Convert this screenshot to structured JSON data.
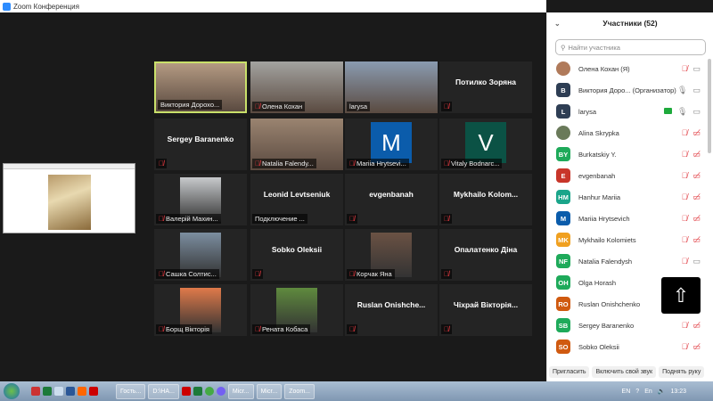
{
  "window": {
    "title": "Zoom Конференция"
  },
  "colors": {
    "accent": "#2d8cff",
    "active_speaker": "#c9e06a",
    "muted": "#e0383e"
  },
  "tiles": [
    {
      "name": "Виктория Дорохо...",
      "type": "video",
      "muted": false,
      "active": true,
      "bg": "#b49a82"
    },
    {
      "name": "Олена Кохан",
      "type": "video",
      "muted": true,
      "bg": "#a3a3a0"
    },
    {
      "name": "larysa",
      "type": "video",
      "muted": false,
      "bg": "#8a9bb0"
    },
    {
      "name": "Потилко Зоряна",
      "type": "text",
      "muted": true
    },
    {
      "name": "Sergey Baranenko",
      "type": "text",
      "muted": true
    },
    {
      "name": "Natalia Falendy...",
      "type": "video",
      "muted": true,
      "bg": "#9a8470"
    },
    {
      "name": "Mariia Hrytsevi...",
      "type": "letter",
      "letter": "M",
      "color": "#0b5cab",
      "muted": true
    },
    {
      "name": "Vitaly Bodnarc...",
      "type": "letter",
      "letter": "V",
      "color": "#0b5245",
      "muted": true
    },
    {
      "name": "Валерій Махин...",
      "type": "pic",
      "bg": "#c7c9cc",
      "muted": true
    },
    {
      "name": "Leonid Levtseniuk",
      "type": "text",
      "status": "Подключение ...",
      "muted": false
    },
    {
      "name": "evgenbanah",
      "type": "text",
      "muted": true
    },
    {
      "name": "Mykhailo  Kolom...",
      "type": "text",
      "muted": true
    },
    {
      "name": "Сашка Солтис...",
      "type": "pic",
      "bg": "#7c8ea0",
      "muted": true
    },
    {
      "name": "Sobko Oleksii",
      "type": "text",
      "muted": true
    },
    {
      "name": "Корчак Яна",
      "type": "pic",
      "bg": "#6b5244",
      "muted": true
    },
    {
      "name": "Опалатенко Діна",
      "type": "text",
      "muted": true
    },
    {
      "name": "Борщ Вікторія",
      "type": "pic",
      "bg": "#e07a4a",
      "muted": true
    },
    {
      "name": "Рената Кобаса",
      "type": "pic",
      "bg": "#5f8a3e",
      "muted": true
    },
    {
      "name": "Ruslan  Onishche...",
      "type": "text",
      "muted": true
    },
    {
      "name": "Чіхрай Вікторія...",
      "type": "text",
      "muted": true
    }
  ],
  "panel": {
    "title": "Участники (52)",
    "search_placeholder": "Найти участника",
    "participants": [
      {
        "initials": "",
        "name": "Олена Кохан (Я)",
        "color": "#b07a5a",
        "mic": "muted",
        "cam": "on"
      },
      {
        "initials": "B",
        "name": "Виктория Доро...  (Организатор)",
        "color": "#2e3e54",
        "mic": "on",
        "cam": "on"
      },
      {
        "initials": "L",
        "name": "larysa",
        "color": "#2e3e54",
        "mic": "on",
        "cam": "on",
        "sharing": true
      },
      {
        "initials": "",
        "name": "Alina Skrypka",
        "color": "#6a7a5a",
        "mic": "muted",
        "cam": "off"
      },
      {
        "initials": "BY",
        "name": "Burkatskiy Y.",
        "color": "#1eaa5a",
        "mic": "muted",
        "cam": "off"
      },
      {
        "initials": "E",
        "name": "evgenbanah",
        "color": "#c8362a",
        "mic": "muted",
        "cam": "off"
      },
      {
        "initials": "HM",
        "name": "Hanhur Mariia",
        "color": "#1aa58a",
        "mic": "muted",
        "cam": "off"
      },
      {
        "initials": "M",
        "name": "Mariia Hrytsevich",
        "color": "#0b5cab",
        "mic": "muted",
        "cam": "off"
      },
      {
        "initials": "MK",
        "name": "Mykhailo Kolomiets",
        "color": "#f0a020",
        "mic": "muted",
        "cam": "off"
      },
      {
        "initials": "NF",
        "name": "Natalia Falendysh",
        "color": "#1eaa5a",
        "mic": "muted",
        "cam": "on"
      },
      {
        "initials": "OH",
        "name": "Olga Horash",
        "color": "#1eaa5a",
        "mic": "",
        "cam": ""
      },
      {
        "initials": "RO",
        "name": "Ruslan Onishchenko",
        "color": "#d05a10",
        "mic": "",
        "cam": ""
      },
      {
        "initials": "SB",
        "name": "Sergey Baranenko",
        "color": "#1eaa5a",
        "mic": "muted",
        "cam": "off"
      },
      {
        "initials": "SO",
        "name": "Sobko Oleksii",
        "color": "#d05a10",
        "mic": "muted",
        "cam": "off"
      }
    ],
    "raise_hand_count": "1",
    "buttons": {
      "invite": "Пригласить",
      "unmute": "Включить свой звук",
      "raise_hand": "Поднять руку"
    }
  },
  "taskbar": {
    "buttons": [
      "Гость...",
      "D:\\НА...",
      "Micr...",
      "Micr...",
      "Zoom..."
    ],
    "lang": "EN",
    "lang2": "En",
    "time": "13:23"
  }
}
